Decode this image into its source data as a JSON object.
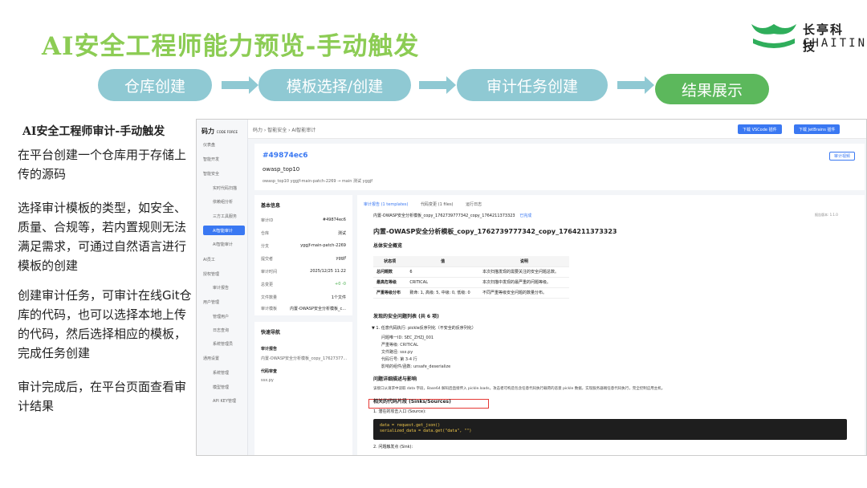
{
  "slide": {
    "title": "AI安全工程师能力预览-手动触发",
    "logo_cn": "长亭科技",
    "logo_en": "CHAITIN",
    "steps": [
      "仓库创建",
      "模板选择/创建",
      "审计任务创建",
      "结果展示"
    ],
    "left_heading": "AI安全工程师审计-手动触发",
    "paragraphs": [
      "在平台创建一个仓库用于存储上传的源码",
      "选择审计模板的类型，如安全、质量、合规等，若内置规则无法满足需求，可通过自然语言进行模板的创建",
      "创建审计任务，可审计在线Git仓库的代码，也可以选择本地上传的代码，然后选择相应的模板，完成任务创建",
      "审计完成后，在平台页面查看审计结果"
    ]
  },
  "app": {
    "brand": "码力",
    "brand_sub": "CODE FORCE",
    "sidebar": [
      "仪表盘",
      "智能开发",
      "智能安全",
      "实时代码扫描",
      "依赖组分析",
      "三方工具服务",
      "AI智能审计",
      "AI智能审计",
      "AI员工",
      "授权管理",
      "审计报告",
      "用户管理",
      "管理用户",
      "日志查询",
      "系统管理员",
      "通用设置",
      "系统管理",
      "模型管理",
      "API KEY管理"
    ],
    "breadcrumb": "码力  ›  智能安全  ›  AI智能审计",
    "btn_vscode": "下载 VSCode 插件",
    "btn_jetbrains": "下载 JetBrains 插件",
    "task_id": "#49874ec6",
    "project": "owasp_top10",
    "meta_line": "owasp_top10    yggjf-main-patch-2269 → main    测试    yggjf",
    "report_btn": "审计视频",
    "basic_info_title": "基本信息",
    "basic_info": [
      {
        "k": "审计ID",
        "v": "#49874ec6"
      },
      {
        "k": "仓库",
        "v": "测试"
      },
      {
        "k": "分支",
        "v": "yggjf-main-patch-2269"
      },
      {
        "k": "提交者",
        "v": "yggjf"
      },
      {
        "k": "审计时间",
        "v": "2025/12/25 11:22"
      },
      {
        "k": "总变更",
        "v": "+0 -0"
      },
      {
        "k": "文件数量",
        "v": "1个文件"
      },
      {
        "k": "审计模板",
        "v": "内置-OWASP安全分析模板_c..."
      }
    ],
    "quick_nav_title": "快速导航",
    "quick_nav": [
      "审计报告",
      "内置-OWASP安全分析模板_copy_17627377...",
      "代码审查",
      "ssx.py"
    ],
    "tabs": [
      "审计报告 (1 templates)",
      "代码变更 (1 files)",
      "运行日志"
    ],
    "template_tag": "内置-OWASP安全分析模板_copy_1762739777342_copy_1764211373323",
    "template_status": "已完成",
    "report_title": "内置-OWASP安全分析模板_copy_1762739777342_copy_1764211373323",
    "overview_title": "总体安全概览",
    "table_headers": [
      "状态项",
      "值",
      "说明"
    ],
    "table_rows": [
      [
        "总问题数",
        "6",
        "本次扫描发现的需要关注的安全问题总数。"
      ],
      [
        "最高危等级",
        "CRITICAL",
        "本次扫描中发现的最严重的问题等级。"
      ],
      [
        "严重等级分布",
        "致命: 1, 高级: 5, 中级: 0, 低级: 0",
        "不同严重等级安全问题的数量分布。"
      ]
    ],
    "issue_list_title": "发现的安全问题列表 (共 6 项)",
    "issue_head": "▼ 1. 任意代码执行: pickle反序列化（不安全的反序列化）",
    "issue_details": [
      "问题唯一ID:   SEC_ZHZJ_001",
      "严重等级:   CRITICAL",
      "文件路径:   ssx.py",
      "代码行号:   第 3-4 行",
      "影响的组件/函数:   unsafe_deserialize"
    ],
    "desc_title": "问题详细描述与影响",
    "desc_text": "该接口从请求中读取 data 字段，Base64 解码后直接传入 pickle.loads，攻击者可构造包含任意代码执行载荷的恶意 pickle 数据，实现服务器端任意代码执行，完全控制应用主机。",
    "sinks_title": "相关的代码片段 (Sinks/Sources)",
    "source_title": "1. 潜在的攻击入口 (Source):",
    "code_lines": [
      "data = request.get_json()",
      "serialized_data = data.get(\"data\", \"\")"
    ],
    "sink_title": "2. 问题触发点 (Sink):",
    "version": "报告版本: 1.1.0"
  },
  "colors": {
    "title": "#8ccc54",
    "step": "#8fc9d3",
    "step_active": "#5cb85c",
    "accent": "#3a78f2"
  }
}
